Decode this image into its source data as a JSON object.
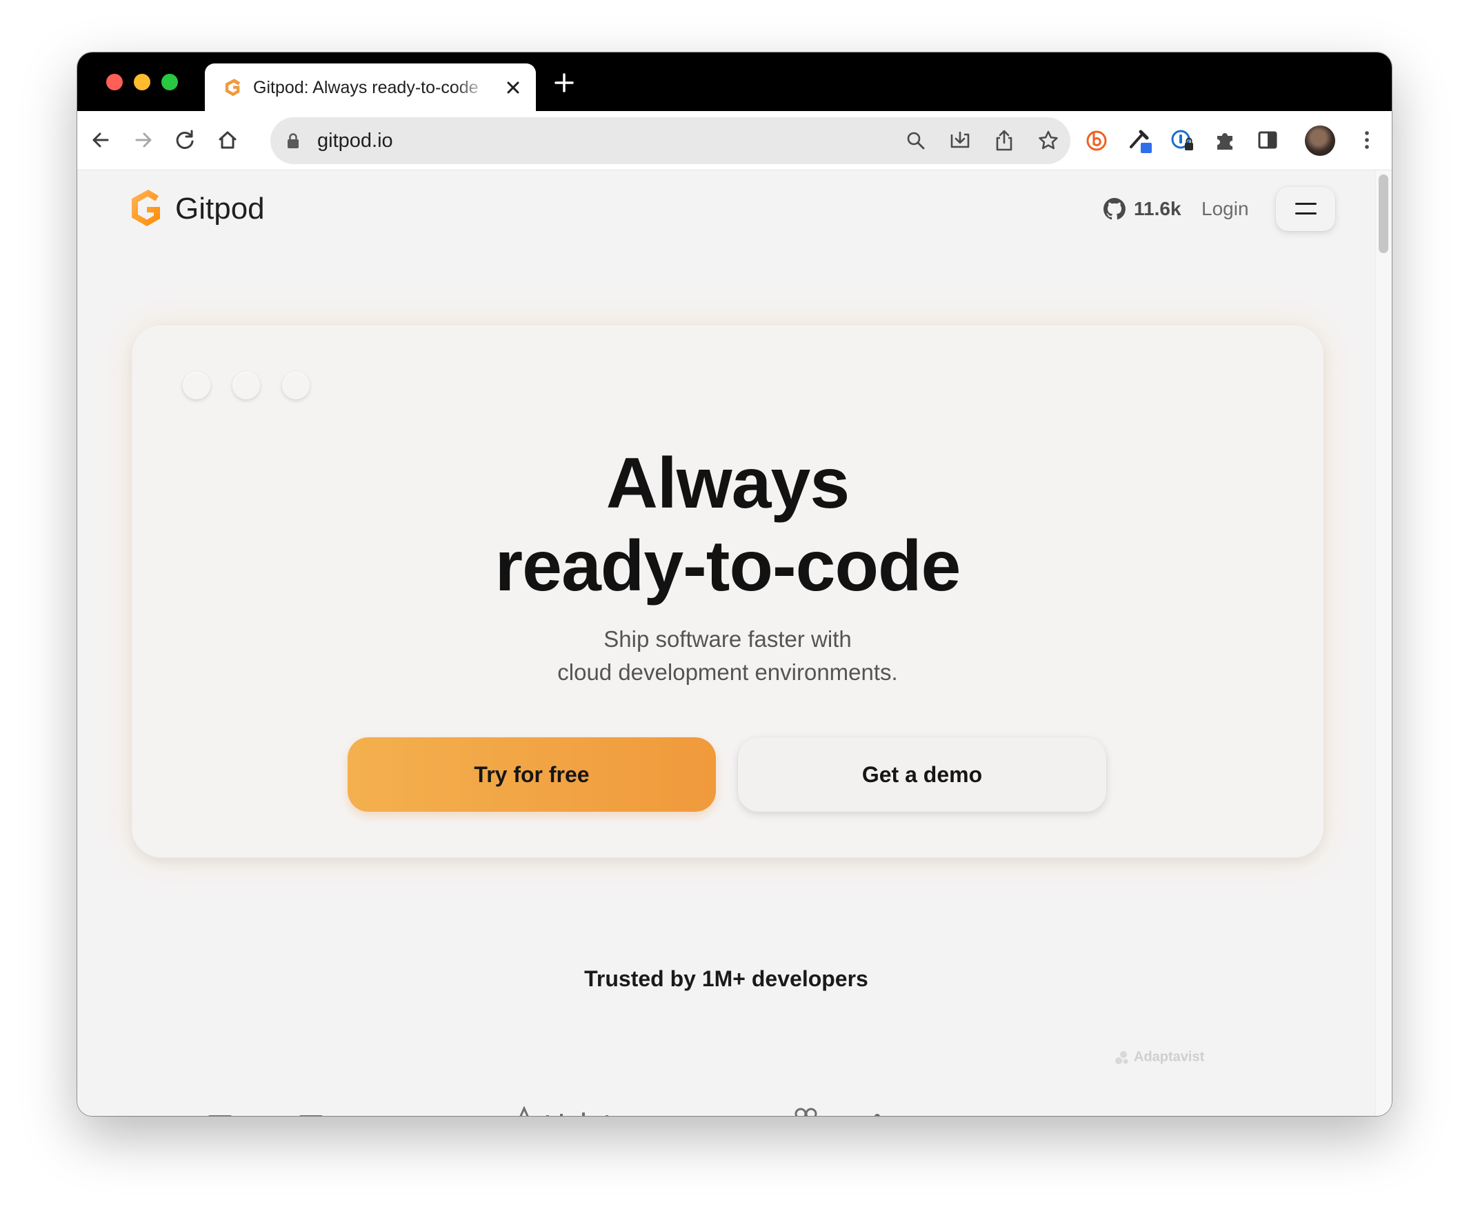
{
  "browser": {
    "tab_title": "Gitpod: Always ready-to-code",
    "url": "gitpod.io",
    "icons": [
      "back-icon",
      "forward-icon",
      "reload-icon",
      "home-icon",
      "lock-icon",
      "search-icon",
      "install-icon",
      "share-icon",
      "star-icon",
      "extension-icons",
      "puzzle-icon",
      "sidebar-icon",
      "kebab-icon"
    ]
  },
  "site": {
    "brand": "Gitpod",
    "github_stars": "11.6k",
    "login_label": "Login",
    "accent": "#f4a142"
  },
  "hero": {
    "title_line1": "Always",
    "title_line2": "ready-to-code",
    "subtitle_line1": "Ship software faster with",
    "subtitle_line2": "cloud development environments.",
    "primary_cta": "Try for free",
    "secondary_cta": "Get a demo"
  },
  "trust": {
    "heading": "Trusted by 1M+ developers",
    "logo_text": "Adaptavist"
  }
}
